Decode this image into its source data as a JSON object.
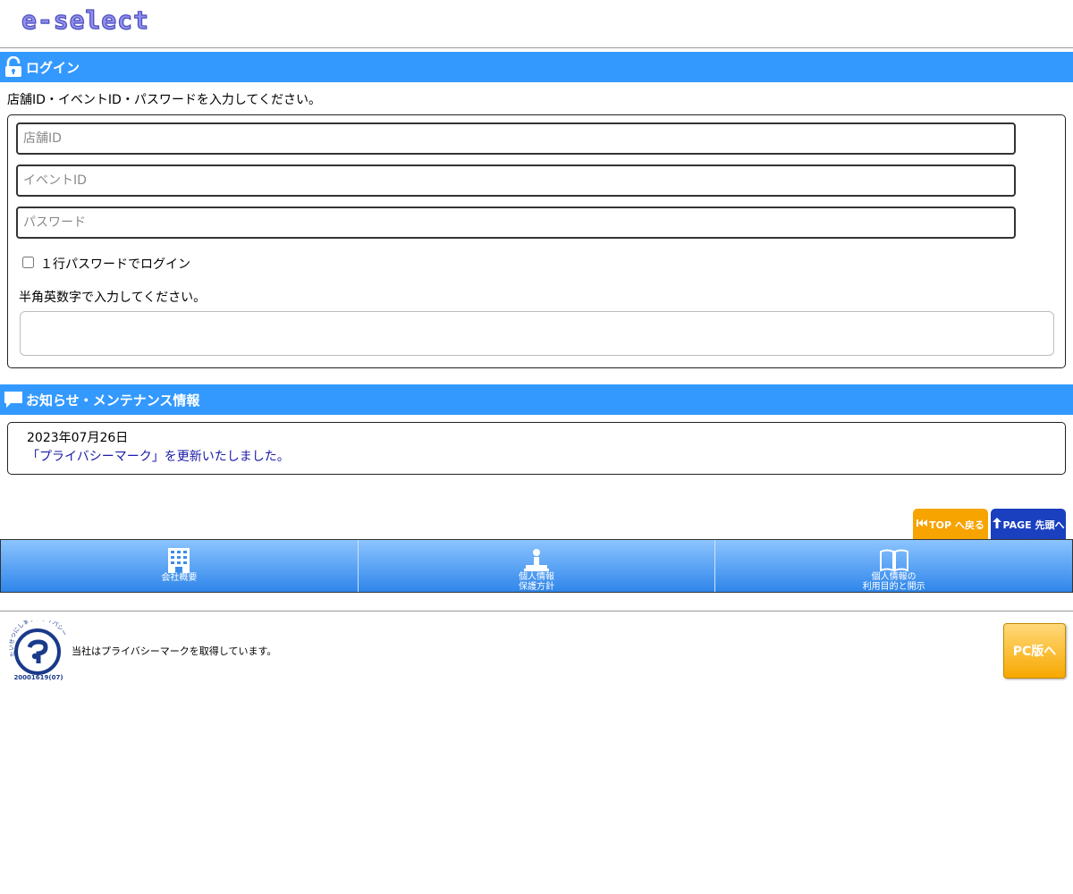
{
  "header": {
    "logo_text": "e-select"
  },
  "login": {
    "title": "ログイン",
    "instruction": "店舗ID・イベントID・パスワードを入力してください。",
    "store_id_placeholder": "店舗ID",
    "event_id_placeholder": "イベントID",
    "password_placeholder": "パスワード",
    "one_line_label": "１行パスワードでログイン",
    "hint": "半角英数字で入力してください。"
  },
  "news": {
    "title": "お知らせ・メンテナンス情報",
    "date": "2023年07月26日",
    "link_text": "「プライバシーマーク」を更新いたしました。"
  },
  "tabs": {
    "top_label": "TOP へ戻る",
    "page_top_label": "PAGE 先頭へ"
  },
  "footer_nav": {
    "company_label": "会社概要",
    "privacy_policy_line1": "個人情報",
    "privacy_policy_line2": "保護方針",
    "usage_line1": "個人情報の",
    "usage_line2": "利用目的と開示"
  },
  "privacy_mark": {
    "arc_text": "たいせつにしますプライバシー",
    "number": "20001619(07)",
    "statement": "当社はプライバシーマークを取得しています。"
  },
  "pc_button_label": "PC版へ",
  "colors": {
    "bar": "#3399ff",
    "top_tab": "#f7a300",
    "page_tab": "#1a3fbf",
    "link": "#1a1aa6"
  }
}
